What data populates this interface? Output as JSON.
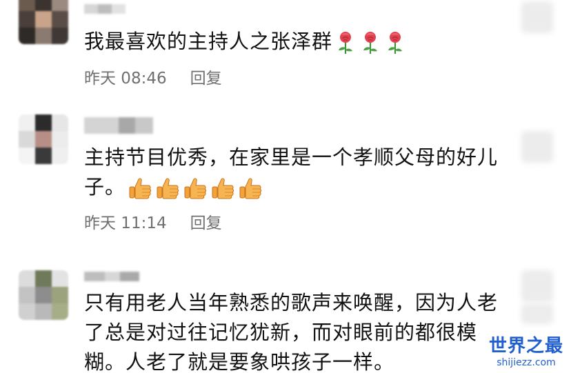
{
  "comments": [
    {
      "text": "我最喜欢的主持人之张泽群",
      "time": "昨天 08:46",
      "reply": "回复",
      "emoji": "rose-icon",
      "emoji_count": 3
    },
    {
      "text": "主持节目优秀，在家里是一个孝顺父母的好儿子。",
      "time": "昨天 11:14",
      "reply": "回复",
      "emoji": "thumbs-up-icon",
      "emoji_count": 5
    },
    {
      "text": "只有用老人当年熟悉的歌声来唤醒，因为人老了总是对过往记忆犹新，而对眼前的都很模糊。人老了就是要象哄孩子一样。"
    }
  ],
  "watermark": {
    "title": "世界之最",
    "url": "shijiezz.com"
  },
  "colors": {
    "meta_text": "#6f6f6f",
    "body_text": "#111111",
    "watermark": "#1f5fcf"
  }
}
